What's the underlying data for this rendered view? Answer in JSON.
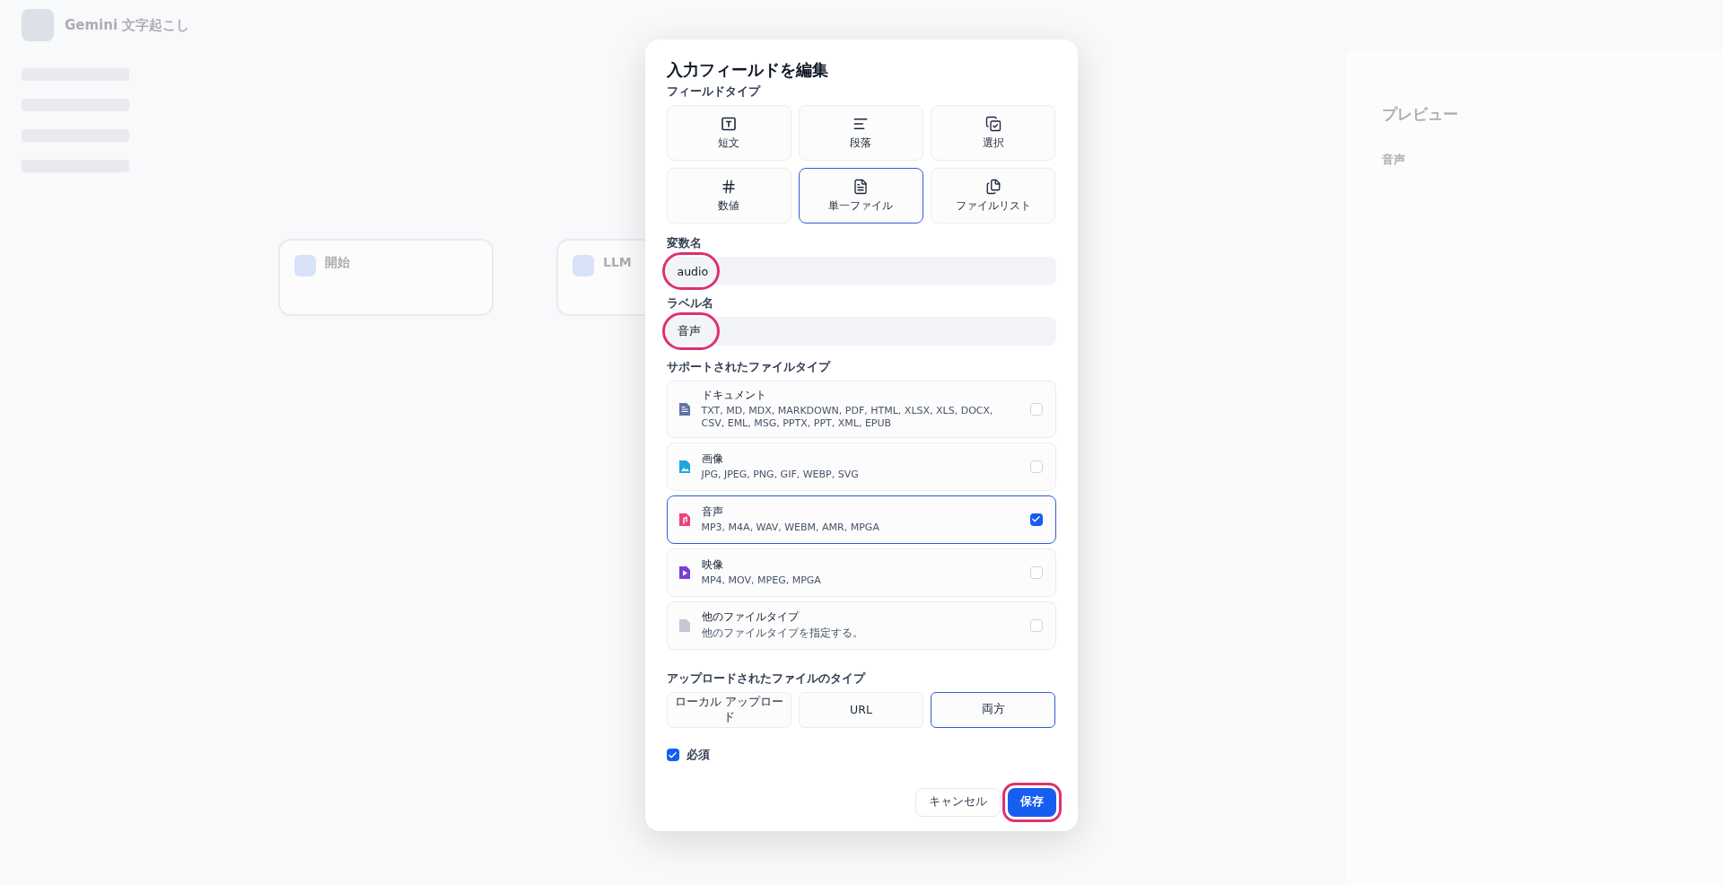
{
  "background": {
    "app_title": "Gemini 文字起こし",
    "nodes": [
      {
        "title": "開始"
      },
      {
        "title": "LLM"
      }
    ],
    "preview": {
      "title": "プレビュー",
      "label": "音声"
    }
  },
  "dialog": {
    "title": "入力フィールドを編集",
    "field_type_label": "フィールドタイプ",
    "field_types": [
      {
        "label": "短文",
        "kind": "short-text",
        "selected": false
      },
      {
        "label": "段落",
        "kind": "paragraph",
        "selected": false
      },
      {
        "label": "選択",
        "kind": "select",
        "selected": false
      },
      {
        "label": "数値",
        "kind": "number",
        "selected": false
      },
      {
        "label": "単一ファイル",
        "kind": "single-file",
        "selected": true
      },
      {
        "label": "ファイルリスト",
        "kind": "file-list",
        "selected": false
      }
    ],
    "variable": {
      "label": "変数名",
      "value": "audio",
      "highlighted": true
    },
    "label_name": {
      "label": "ラベル名",
      "value": "音声",
      "highlighted": true
    },
    "supported_label": "サポートされたファイルタイプ",
    "file_types": [
      {
        "kind": "document",
        "name": "ドキュメント",
        "formats": "TXT, MD, MDX, MARKDOWN, PDF, HTML, XLSX, XLS, DOCX, CSV, EML, MSG, PPTX, PPT, XML, EPUB",
        "checked": false
      },
      {
        "kind": "image",
        "name": "画像",
        "formats": "JPG, JPEG, PNG, GIF, WEBP, SVG",
        "checked": false
      },
      {
        "kind": "audio",
        "name": "音声",
        "formats": "MP3, M4A, WAV, WEBM, AMR, MPGA",
        "checked": true
      },
      {
        "kind": "video",
        "name": "映像",
        "formats": "MP4, MOV, MPEG, MPGA",
        "checked": false
      },
      {
        "kind": "other",
        "name": "他のファイルタイプ",
        "formats": "他のファイルタイプを指定する。",
        "checked": false
      }
    ],
    "upload_label": "アップロードされたファイルのタイプ",
    "upload_methods": [
      {
        "label": "ローカル アップロード",
        "selected": false
      },
      {
        "label": "URL",
        "selected": false
      },
      {
        "label": "両方",
        "selected": true
      }
    ],
    "required": {
      "label": "必須",
      "checked": true
    },
    "buttons": [
      {
        "kind": "cancel",
        "label": "キャンセル",
        "highlighted": false
      },
      {
        "kind": "save",
        "label": "保存",
        "highlighted": true
      }
    ]
  }
}
